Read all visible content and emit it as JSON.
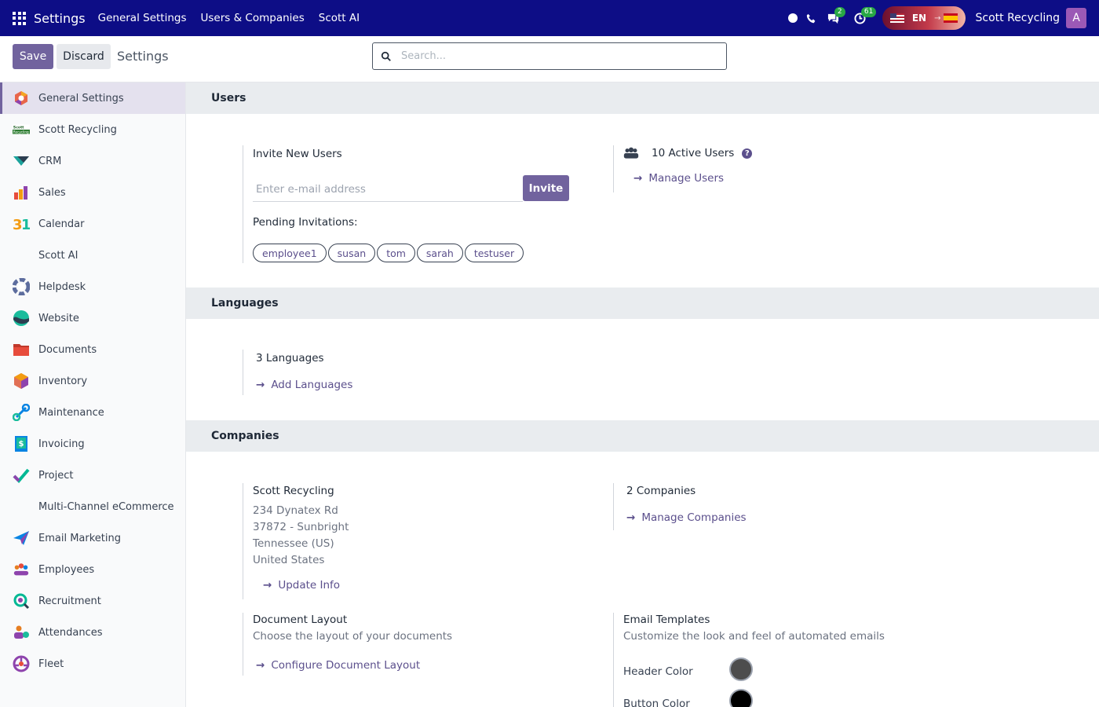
{
  "topbar": {
    "brand": "Settings",
    "nav": [
      "General Settings",
      "Users & Companies",
      "Scott AI"
    ],
    "messages_count": "2",
    "activities_count": "61",
    "lang_code": "EN",
    "company": "Scott Recycling",
    "avatar_letter": "A"
  },
  "control": {
    "save": "Save",
    "discard": "Discard",
    "title": "Settings",
    "search_placeholder": "Search..."
  },
  "sidebar": {
    "items": [
      {
        "label": "General Settings",
        "icon": "settings-app-icon",
        "color": "#e8664a"
      },
      {
        "label": "Scott Recycling",
        "icon": "scott-recycling-logo",
        "color": "#2e7d32"
      },
      {
        "label": "CRM",
        "icon": "crm-icon",
        "color": "#1ba39c"
      },
      {
        "label": "Sales",
        "icon": "sales-icon",
        "color": "#e74c3c"
      },
      {
        "label": "Calendar",
        "icon": "calendar-icon",
        "color": "#f39c12"
      },
      {
        "label": "Scott AI",
        "icon": "",
        "color": ""
      },
      {
        "label": "Helpdesk",
        "icon": "helpdesk-icon",
        "color": "#5d6d9e"
      },
      {
        "label": "Website",
        "icon": "website-icon",
        "color": "#1abc9c"
      },
      {
        "label": "Documents",
        "icon": "documents-icon",
        "color": "#d63031"
      },
      {
        "label": "Inventory",
        "icon": "inventory-icon",
        "color": "#e17055"
      },
      {
        "label": "Maintenance",
        "icon": "maintenance-icon",
        "color": "#0984e3"
      },
      {
        "label": "Invoicing",
        "icon": "invoicing-icon",
        "color": "#0984e3"
      },
      {
        "label": "Project",
        "icon": "project-icon",
        "color": "#00b894"
      },
      {
        "label": "Multi-Channel eCommerce",
        "icon": "",
        "color": ""
      },
      {
        "label": "Email Marketing",
        "icon": "email-marketing-icon",
        "color": "#0984e3"
      },
      {
        "label": "Employees",
        "icon": "employees-icon",
        "color": "#e67e22"
      },
      {
        "label": "Recruitment",
        "icon": "recruitment-icon",
        "color": "#00b894"
      },
      {
        "label": "Attendances",
        "icon": "attendances-icon",
        "color": "#e67e22"
      },
      {
        "label": "Fleet",
        "icon": "fleet-icon",
        "color": "#8e44ad"
      }
    ]
  },
  "users": {
    "heading": "Users",
    "invite_title": "Invite New Users",
    "email_placeholder": "Enter e-mail address",
    "invite_button": "Invite",
    "pending_title": "Pending Invitations:",
    "pending": [
      "employee1",
      "susan",
      "tom",
      "sarah",
      "testuser"
    ],
    "active_users": "10 Active Users",
    "manage_users": "Manage Users"
  },
  "languages": {
    "heading": "Languages",
    "count": "3 Languages",
    "add": "Add Languages"
  },
  "companies": {
    "heading": "Companies",
    "name": "Scott Recycling",
    "address": [
      "234 Dynatex Rd",
      "37872 - Sunbright",
      "Tennessee (US)",
      "United States"
    ],
    "update": "Update Info",
    "count": "2 Companies",
    "manage": "Manage Companies",
    "doc_layout_title": "Document Layout",
    "doc_layout_desc": "Choose the layout of your documents",
    "doc_layout_link": "Configure Document Layout",
    "email_tpl_title": "Email Templates",
    "email_tpl_desc": "Customize the look and feel of automated emails",
    "header_color_label": "Header Color",
    "header_color": "#4d4d4d",
    "button_color_label": "Button Color",
    "button_color": "#000000"
  }
}
